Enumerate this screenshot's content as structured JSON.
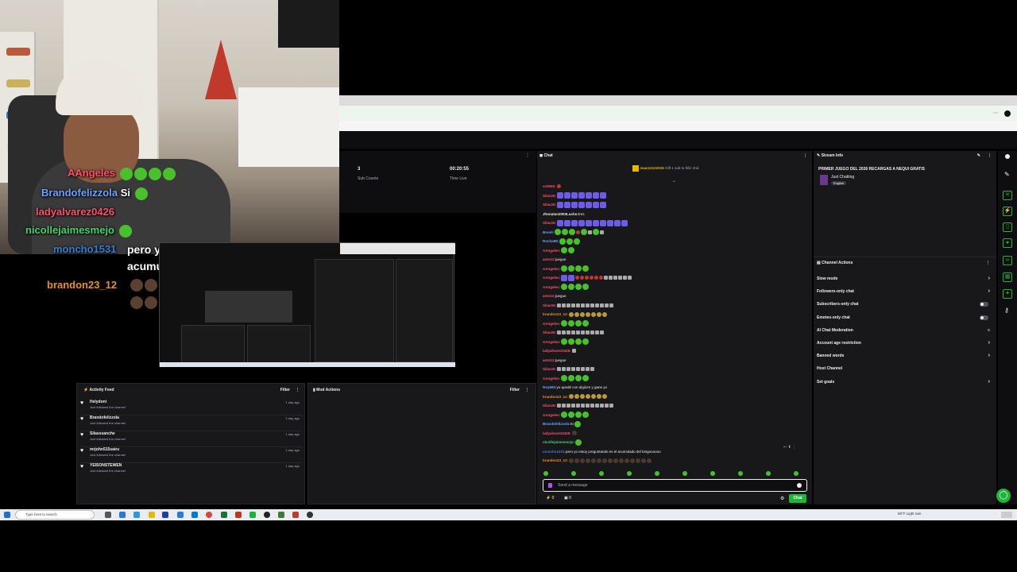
{
  "stream_overlay": {
    "chat_lines": [
      {
        "user": "AAngeles",
        "color": "#ff4f6e"
      },
      {
        "user": "Brandofelizzola",
        "color": "#6ea0ff",
        "text": "Si"
      },
      {
        "user": "ladyalvarez0426",
        "color": "#ff4f6e"
      },
      {
        "user": "nicollejaimesmejo",
        "color": "#44d36e"
      },
      {
        "user": "moncho1531",
        "color": "#3a7bd5"
      }
    ],
    "highlight_message": "pero yo estoy preguntando es el acumulado del bingoooooo",
    "highlight_user": "brandon23_12",
    "highlight_user_color": "#e6902e"
  },
  "stats": {
    "sub_count_value": "3",
    "sub_count_label": "Sub Counts",
    "time_live_value": "00:20:55",
    "time_live_label": "Time Live"
  },
  "activity_feed": {
    "title": "Activity Feed",
    "filter_label": "Filter",
    "items": [
      {
        "name": "Helydoni",
        "sub": "Just followed the channel",
        "time": "1 day ago"
      },
      {
        "name": "Brandofelizzola",
        "sub": "Just followed the channel",
        "time": "1 day ago"
      },
      {
        "name": "Silasssanche",
        "sub": "Just followed the channel",
        "time": "1 day ago"
      },
      {
        "name": "mrjohn515sairu",
        "sub": "Just followed the channel",
        "time": "1 day ago"
      },
      {
        "name": "YEISONSTEWEN",
        "sub": "Just followed the channel",
        "time": "1 day ago"
      }
    ]
  },
  "mod_actions": {
    "title": "Mod Actions",
    "filter_label": "Filter"
  },
  "chat": {
    "title": "Chat",
    "pinned_user": "Juan12122015",
    "pinned_text": "Gift 1 sub to feliz 2nd",
    "messages": [
      {
        "user": "sv0600:",
        "color": "#ff4f6e",
        "text": "",
        "emotes": "r"
      },
      {
        "user": "Silas26:",
        "color": "#ff4f6e",
        "text": "",
        "emotes": "bbbbbbb"
      },
      {
        "user": "Silas26:",
        "color": "#ff4f6e",
        "text": "",
        "emotes": "bbbbbbb"
      },
      {
        "user": "Jhonatan2003Lucho:",
        "color": "#efeff1",
        "text": "tres",
        "emotes": ""
      },
      {
        "user": "Silas26:",
        "color": "#ff4f6e",
        "text": "",
        "emotes": "bbbbbbbbbb"
      },
      {
        "user": "Brenli:",
        "color": "#6ea0ff",
        "text": "",
        "emotes": "gggrgsgs"
      },
      {
        "user": "Rocha88:",
        "color": "#6ea0ff",
        "text": "",
        "emotes": "ggg"
      },
      {
        "user": "AAngeles:",
        "color": "#ff4f6e",
        "text": "",
        "emotes": "gg"
      },
      {
        "user": "anto12:",
        "color": "#ff4f6e",
        "text": "juegue",
        "emotes": ""
      },
      {
        "user": "AAngeles:",
        "color": "#ff4f6e",
        "text": "",
        "emotes": "gggg"
      },
      {
        "user": "AAngeles:",
        "color": "#ff4f6e",
        "text": "",
        "emotes": "bbrrrrrrssssss"
      },
      {
        "user": "AAngeles:",
        "color": "#ff4f6e",
        "text": "",
        "emotes": "gggg"
      },
      {
        "user": "anto12:",
        "color": "#ff4f6e",
        "text": "juegue",
        "emotes": ""
      },
      {
        "user": "Silas26:",
        "color": "#ff4f6e",
        "text": "",
        "emotes": "ssssssssssss"
      },
      {
        "user": "brandon23_12:",
        "color": "#e6902e",
        "text": "",
        "emotes": "yyyyyyy"
      },
      {
        "user": "AAngeles:",
        "color": "#ff4f6e",
        "text": "",
        "emotes": "gggg"
      },
      {
        "user": "Silas26:",
        "color": "#ff4f6e",
        "text": "",
        "emotes": "ssssssssss"
      },
      {
        "user": "AAngeles:",
        "color": "#ff4f6e",
        "text": "",
        "emotes": "gggg"
      },
      {
        "user": "ladyalvarez0426:",
        "color": "#ff4f6e",
        "text": "",
        "emotes": "s"
      },
      {
        "user": "anto12:",
        "color": "#ff4f6e",
        "text": "juegue",
        "emotes": ""
      },
      {
        "user": "Silas26:",
        "color": "#ff4f6e",
        "text": "",
        "emotes": "ssssssss"
      },
      {
        "user": "AAngeles:",
        "color": "#ff4f6e",
        "text": "",
        "emotes": "gggg"
      },
      {
        "user": "Roy660:",
        "color": "#6ea0ff",
        "text": "yo quedé con algúien y gane yo",
        "emotes": ""
      },
      {
        "user": "brandon23_12:",
        "color": "#e6902e",
        "text": "",
        "emotes": "yyyyyyy"
      },
      {
        "user": "Silas26:",
        "color": "#ff4f6e",
        "text": "",
        "emotes": "ssssssssssss"
      },
      {
        "user": "AAngeles:",
        "color": "#ff4f6e",
        "text": "",
        "emotes": "gggg"
      },
      {
        "user": "Brandofelizzola:",
        "color": "#6ea0ff",
        "text": "Si",
        "emotes": "g"
      },
      {
        "user": "ladyalvarez0426:",
        "color": "#ff4f6e",
        "text": "",
        "emotes": "k"
      },
      {
        "user": "nicollejaimesmejo:",
        "color": "#44d36e",
        "text": "",
        "emotes": "g"
      },
      {
        "user": "moncho1531:",
        "color": "#3a7bd5",
        "text": "pero yo estoy preguntando es el acumulado del bingoooooo",
        "emotes": ""
      },
      {
        "user": "brandon23_12:",
        "color": "#e6902e",
        "text": "",
        "emotes": "kkkkkkkkkkkkkkk"
      }
    ],
    "input_placeholder": "Send a message",
    "points": "0",
    "counter": "0",
    "chat_button": "Chat"
  },
  "stream_info": {
    "title": "Stream Info",
    "stream_title": "PRIMER JUEGO DEL 2026 RECARGAS A NEQUI GRATIS",
    "category": "Just Chatting",
    "tag": "English"
  },
  "channel_actions": {
    "title": "Channel Actions",
    "items": [
      {
        "label": "Slow mode",
        "control": "chevron"
      },
      {
        "label": "Followers-only chat",
        "control": "chevron"
      },
      {
        "label": "Subscribers-only chat",
        "control": "toggle"
      },
      {
        "label": "Emotes-only chat",
        "control": "toggle"
      },
      {
        "label": "AI Chat Moderation",
        "control": "settings"
      },
      {
        "label": "Account age restriction",
        "control": "chevron"
      },
      {
        "label": "Banned words",
        "control": "chevron"
      },
      {
        "label": "Host Channel",
        "control": "none"
      },
      {
        "label": "Set goals",
        "control": "chevron"
      }
    ]
  },
  "taskbar": {
    "search_placeholder": "Type here to search",
    "weather": "58°F  Light rain"
  },
  "colors": {
    "accent": "#1fb53a",
    "panel": "#18181b",
    "background": "#0e0e10"
  }
}
